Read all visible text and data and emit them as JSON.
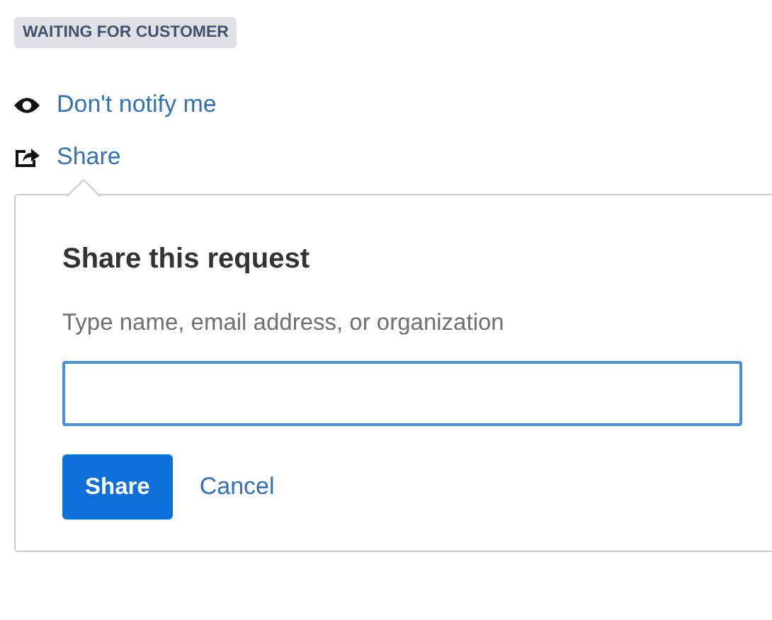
{
  "status_badge": "WAITING FOR CUSTOMER",
  "actions": [
    {
      "kind": "watch",
      "label": "Don't notify me"
    },
    {
      "kind": "share",
      "label": "Share"
    }
  ],
  "share_popover": {
    "title": "Share this request",
    "field_label": "Type name, email address, or organization",
    "primary_button": "Share",
    "secondary_button": "Cancel"
  }
}
